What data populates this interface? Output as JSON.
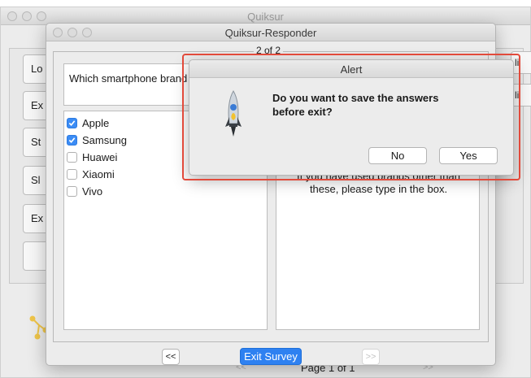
{
  "background_window": {
    "title": "Quiksur",
    "side_buttons": [
      "Lo",
      "Ex",
      "St",
      "Sl",
      "Ex",
      ""
    ],
    "right_buttons": [
      "li",
      "li"
    ],
    "nav_prev": "<<",
    "nav_next": ">>",
    "page_label": "Page 1 of 1"
  },
  "window": {
    "title": "Quiksur-Responder",
    "group_label": "2 of 2",
    "question": "Which smartphone brand h",
    "options": [
      {
        "label": "Apple",
        "checked": true
      },
      {
        "label": "Samsung",
        "checked": true
      },
      {
        "label": "Huawei",
        "checked": false
      },
      {
        "label": "Xiaomi",
        "checked": false
      },
      {
        "label": "Vivo",
        "checked": false
      }
    ],
    "hint_line1": "If you have used brands other than",
    "hint_line2": "these, please type in the box.",
    "prev_label": "<<",
    "exit_label": "Exit Survey",
    "next_label": ">>"
  },
  "alert": {
    "title": "Alert",
    "message_line1": "Do you want to save the answers",
    "message_line2": "before exit?",
    "icon": "rocket-icon",
    "no_label": "No",
    "yes_label": "Yes"
  },
  "colors": {
    "accent": "#2e81f1",
    "checkbox": "#3b8cf5",
    "highlight": "#e24a3b"
  }
}
